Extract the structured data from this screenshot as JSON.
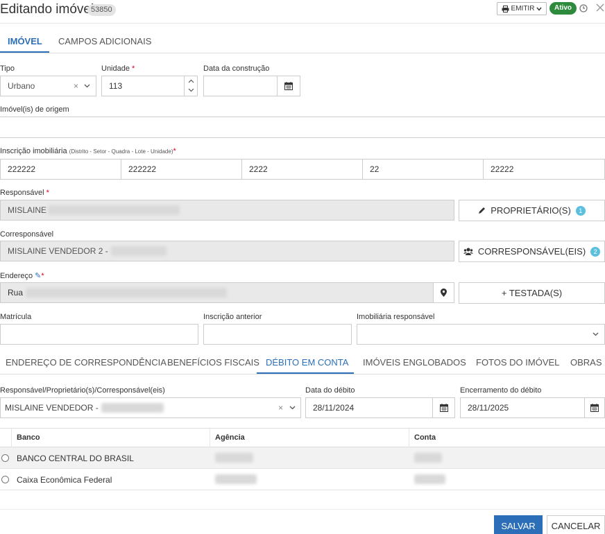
{
  "header": {
    "title": "Editando imóvel",
    "id_badge": "53850",
    "emitir_label": "EMITIR",
    "status_label": "Ativo"
  },
  "main_tabs": [
    {
      "label": "IMÓVEL",
      "active": true
    },
    {
      "label": "CAMPOS ADICIONAIS",
      "active": false
    }
  ],
  "form": {
    "tipo": {
      "label": "Tipo",
      "value": "Urbano"
    },
    "unidade": {
      "label": "Unidade",
      "value": "113"
    },
    "data_construcao": {
      "label": "Data da construção",
      "value": ""
    },
    "imoveis_origem": {
      "label": "Imóvel(is) de origem",
      "value": ""
    },
    "inscricao": {
      "label": "Inscrição imobiliária",
      "hint": "(Distrito - Setor - Quadra - Lote - Unidade)",
      "parts": [
        "222222",
        "222222",
        "2222",
        "22",
        "22222"
      ]
    },
    "responsavel": {
      "label": "Responsável",
      "value": "MISLAINE",
      "button_label": "PROPRIETÁRIO(S)",
      "count": "1"
    },
    "corresponsavel": {
      "label": "Corresponsável",
      "value": "MISLAINE VENDEDOR 2 -",
      "button_label": "CORRESPONSÁVEL(EIS)",
      "count": "2"
    },
    "endereco": {
      "label": "Endereço",
      "value": "Rua",
      "button_label": "+ TESTADA(S)"
    },
    "matricula": {
      "label": "Matrícula",
      "value": ""
    },
    "inscricao_anterior": {
      "label": "Inscrição anterior",
      "value": ""
    },
    "imobiliaria": {
      "label": "Imobiliária responsável",
      "value": ""
    }
  },
  "section_tabs": [
    {
      "label": "ENDEREÇO DE CORRESPONDÊNCIA",
      "active": false
    },
    {
      "label": "BENEFÍCIOS FISCAIS",
      "active": false
    },
    {
      "label": "DÉBITO EM CONTA",
      "active": true
    },
    {
      "label": "IMÓVEIS ENGLOBADOS",
      "active": false
    },
    {
      "label": "FOTOS DO IMÓVEL",
      "active": false
    },
    {
      "label": "OBRAS",
      "active": false
    }
  ],
  "debito": {
    "responsavel": {
      "label": "Responsável/Proprietário(s)/Corresponsável(eis)",
      "value": "MISLAINE VENDEDOR -"
    },
    "data_debito": {
      "label": "Data do débito",
      "value": "28/11/2024"
    },
    "encerramento": {
      "label": "Encerramento do débito",
      "value": "28/11/2025"
    }
  },
  "bank_table": {
    "columns": [
      "Banco",
      "Agência",
      "Conta"
    ],
    "rows": [
      {
        "banco": "BANCO CENTRAL DO BRASIL"
      },
      {
        "banco": "Caixa Econômica Federal"
      }
    ]
  },
  "footer": {
    "save_label": "SALVAR",
    "cancel_label": "CANCELAR"
  },
  "colors": {
    "primary": "#2c6fb8",
    "status_active": "#2e8b3e",
    "badge_info": "#5bc0de",
    "required": "#d0021b"
  }
}
